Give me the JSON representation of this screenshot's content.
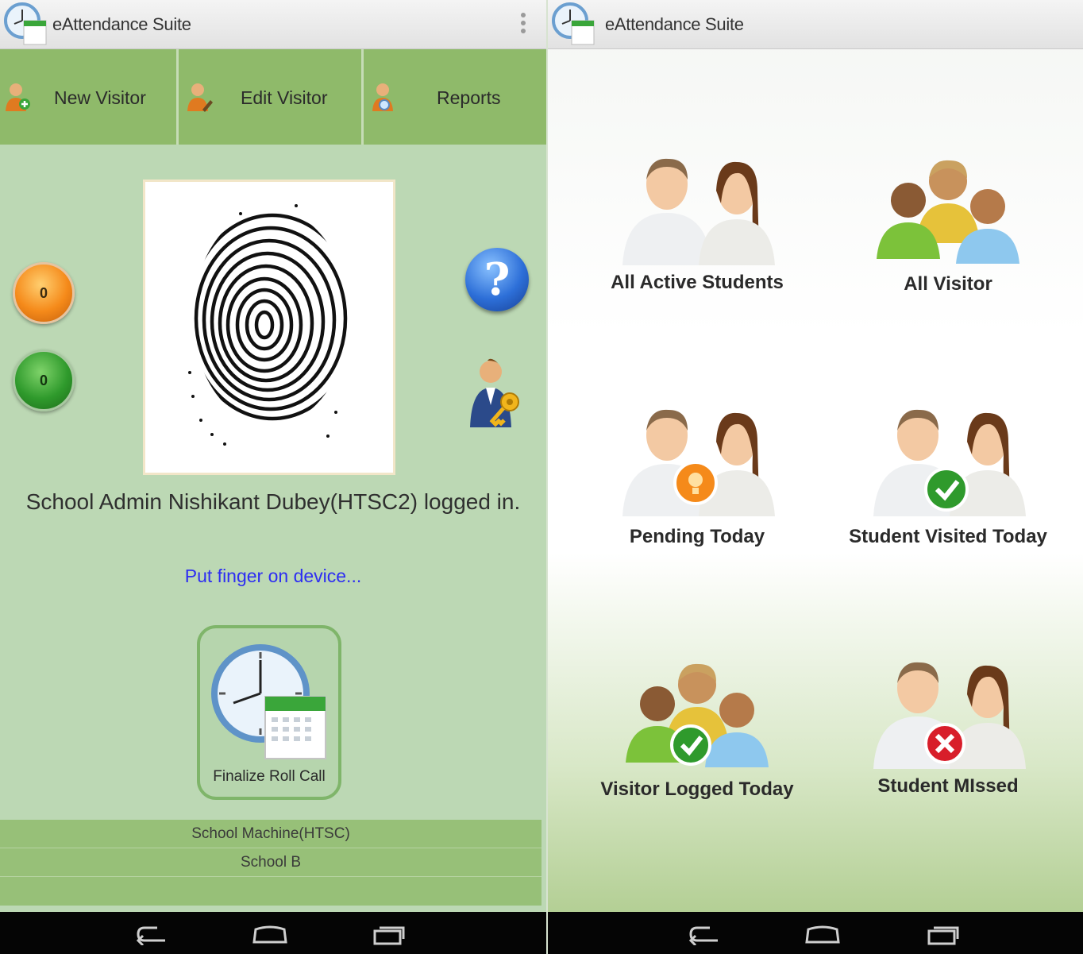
{
  "app": {
    "title": "eAttendance Suite"
  },
  "left_screen": {
    "toolbar": {
      "items": [
        {
          "label": "New Visitor",
          "icon": "add-person-icon"
        },
        {
          "label": "Edit Visitor",
          "icon": "edit-person-icon"
        },
        {
          "label": "Reports",
          "icon": "report-person-icon"
        }
      ]
    },
    "counters": {
      "orange_value": "0",
      "green_value": "0"
    },
    "help_label": "?",
    "login_status": "School Admin Nishikant Dubey(HTSC2) logged in.",
    "prompt": "Put finger on device...",
    "finalize_label": "Finalize Roll Call",
    "footer": {
      "machine": "School Machine(HTSC)",
      "school": "School B"
    }
  },
  "right_screen": {
    "tiles": [
      {
        "label": "All Active Students",
        "icon": "students-pair-icon"
      },
      {
        "label": "All Visitor",
        "icon": "visitor-group-icon"
      },
      {
        "label": "Pending Today",
        "icon": "students-pending-icon"
      },
      {
        "label": "Student Visited Today",
        "icon": "students-check-icon"
      },
      {
        "label": "Visitor Logged Today",
        "icon": "visitor-check-icon"
      },
      {
        "label": "Student MIssed",
        "icon": "students-missed-icon"
      }
    ]
  },
  "colors": {
    "toolbar_green": "#8fba6a",
    "panel_green": "#bcd8b4",
    "prompt_blue": "#2d2df2",
    "check_green": "#2f9a2c",
    "missed_red": "#d81e2a",
    "pending_orange": "#f58a1a"
  }
}
